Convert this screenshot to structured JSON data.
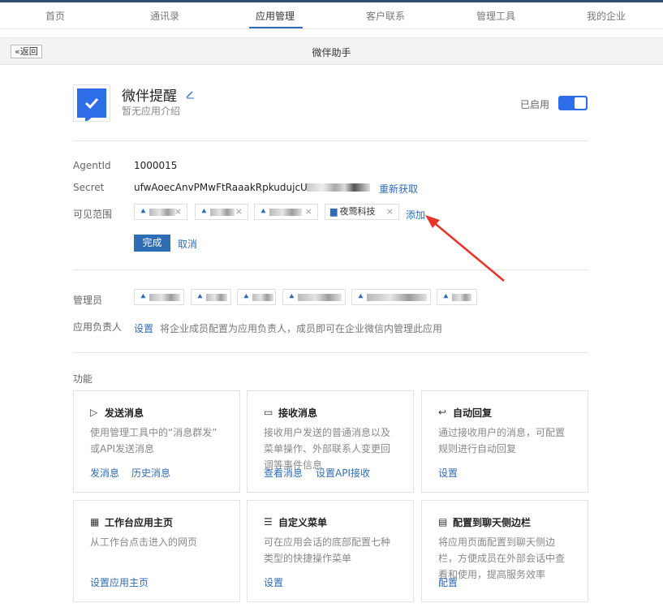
{
  "nav": {
    "tabs": [
      "首页",
      "通讯录",
      "应用管理",
      "客户联系",
      "管理工具",
      "我的企业"
    ],
    "active_index": 2
  },
  "subbar": {
    "back_label": "«返回",
    "title": "微伴助手"
  },
  "app": {
    "name": "微伴提醒",
    "description": "暂无应用介绍",
    "enabled_label": "已启用",
    "enabled": true,
    "icon_color": "#2d6ee8"
  },
  "fields": {
    "agentid_label": "AgentId",
    "agentid_value": "1000015",
    "secret_label": "Secret",
    "secret_value": "ufwAoecAnvPMwFtRaaakRpkudujcUD",
    "refresh_label": "重新获取",
    "visible_label": "可见范围",
    "visible_chips": [
      {
        "type": "person",
        "text": ""
      },
      {
        "type": "person",
        "text": ""
      },
      {
        "type": "person",
        "text": ""
      },
      {
        "type": "dept",
        "text": "夜莺科技"
      }
    ],
    "add_label": "添加",
    "done_label": "完成",
    "cancel_label": "取消"
  },
  "admins": {
    "label": "管理员",
    "chips": [
      "",
      "",
      "",
      "",
      "",
      ""
    ]
  },
  "owner": {
    "label": "应用负责人",
    "set_label": "设置",
    "hint": "将企业成员配置为应用负责人，成员即可在企业微信内管理此应用"
  },
  "features": {
    "label": "功能",
    "cards": [
      {
        "icon": "send-icon",
        "glyph": "▷",
        "title": "发送消息",
        "desc": [
          "使用管理工具中的“消息群发”",
          "或API发送消息"
        ],
        "links": [
          "发消息",
          "历史消息"
        ]
      },
      {
        "icon": "message-icon",
        "glyph": "▭",
        "title": "接收消息",
        "desc": [
          "接收用户发送的普通消息以及",
          "菜单操作、外部联系人变更回",
          "调等事件信息"
        ],
        "links": [
          "查看消息",
          "设置API接收"
        ]
      },
      {
        "icon": "reply-icon",
        "glyph": "↩",
        "title": "自动回复",
        "desc": [
          "通过接收用户的消息，可配置",
          "规则进行自动回复"
        ],
        "links": [
          "设置"
        ]
      },
      {
        "icon": "grid-icon",
        "glyph": "▦",
        "title": "工作台应用主页",
        "desc": [
          "从工作台点击进入的网页"
        ],
        "links": [
          "设置应用主页"
        ]
      },
      {
        "icon": "menu-icon",
        "glyph": "☰",
        "title": "自定义菜单",
        "desc": [
          "可在应用会话的底部配置七种",
          "类型的快捷操作菜单"
        ],
        "links": [
          "设置"
        ]
      },
      {
        "icon": "sidebar-icon",
        "glyph": "▤",
        "title": "配置到聊天侧边栏",
        "desc": [
          "将应用页面配置到聊天侧边",
          "栏，方便成员在外部会话中查",
          "看和使用，提高服务效率"
        ],
        "links": [
          "配置"
        ]
      }
    ]
  },
  "colors": {
    "accent": "#2f6cb6",
    "nav_border": "#2f4d73",
    "annotation_arrow": "#e8332b"
  }
}
